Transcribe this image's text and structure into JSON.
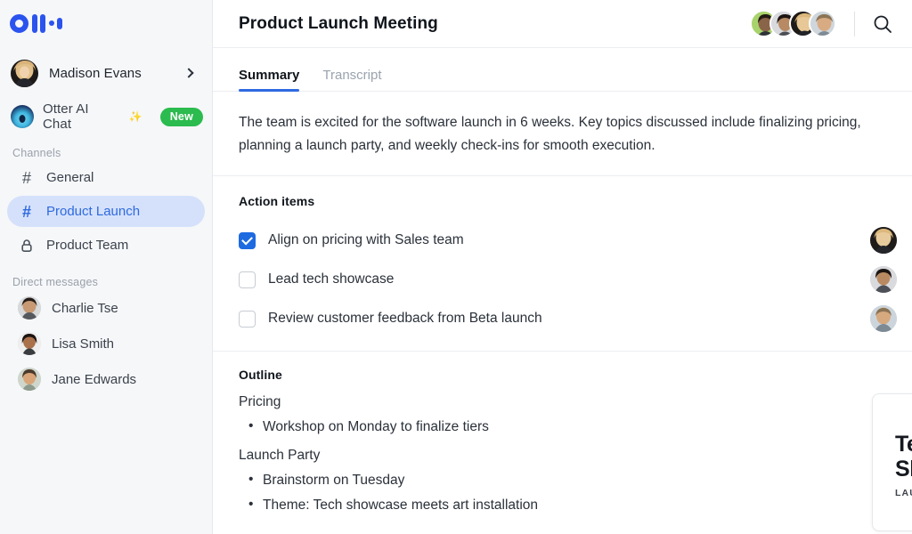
{
  "sidebar": {
    "logo_name": "otter-logo",
    "user": {
      "name": "Madison Evans",
      "chevron": "chevron-right-icon"
    },
    "ai_chat": {
      "label": "Otter AI Chat",
      "sparkle": "✨",
      "badge": "New"
    },
    "channels_heading": "Channels",
    "channels": [
      {
        "label": "General",
        "icon": "hash-icon",
        "active": false
      },
      {
        "label": "Product Launch",
        "icon": "hash-icon",
        "active": true
      },
      {
        "label": "Product Team",
        "icon": "lock-icon",
        "active": false
      }
    ],
    "dm_heading": "Direct messages",
    "direct_messages": [
      {
        "name": "Charlie Tse"
      },
      {
        "name": "Lisa Smith"
      },
      {
        "name": "Jane Edwards"
      }
    ]
  },
  "header": {
    "title": "Product Launch Meeting",
    "participant_count": 4,
    "search_icon": "search-icon"
  },
  "tabs": [
    {
      "label": "Summary",
      "active": true
    },
    {
      "label": "Transcript",
      "active": false
    }
  ],
  "summary": {
    "text": "The team is excited for the software launch in 6 weeks. Key topics discussed include finalizing pricing, planning a launch party, and weekly check-ins for smooth execution."
  },
  "action_items": {
    "heading": "Action items",
    "items": [
      {
        "text": "Align on pricing with Sales team",
        "checked": true
      },
      {
        "text": "Lead tech showcase",
        "checked": false
      },
      {
        "text": "Review customer feedback from Beta launch",
        "checked": false
      }
    ]
  },
  "outline": {
    "heading": "Outline",
    "sections": [
      {
        "topic": "Pricing",
        "bullets": [
          "Workshop on Monday to finalize tiers"
        ]
      },
      {
        "topic": "Launch Party",
        "bullets": [
          "Brainstorm on Tuesday",
          "Theme: Tech showcase meets art installation"
        ]
      }
    ]
  },
  "promo_card": {
    "title_line1": "Tech",
    "title_line2": "Showcase",
    "subtitle": "LAUNCH PARTY"
  },
  "colors": {
    "brand_blue": "#2b53ee",
    "accent_blue": "#2f6ae0",
    "active_pill": "#d5e1fb",
    "badge_green": "#2bbb4e",
    "checkbox_blue": "#1e6ae1",
    "art_teal": "#14e0ad",
    "sidebar_bg": "#f6f7f9"
  }
}
